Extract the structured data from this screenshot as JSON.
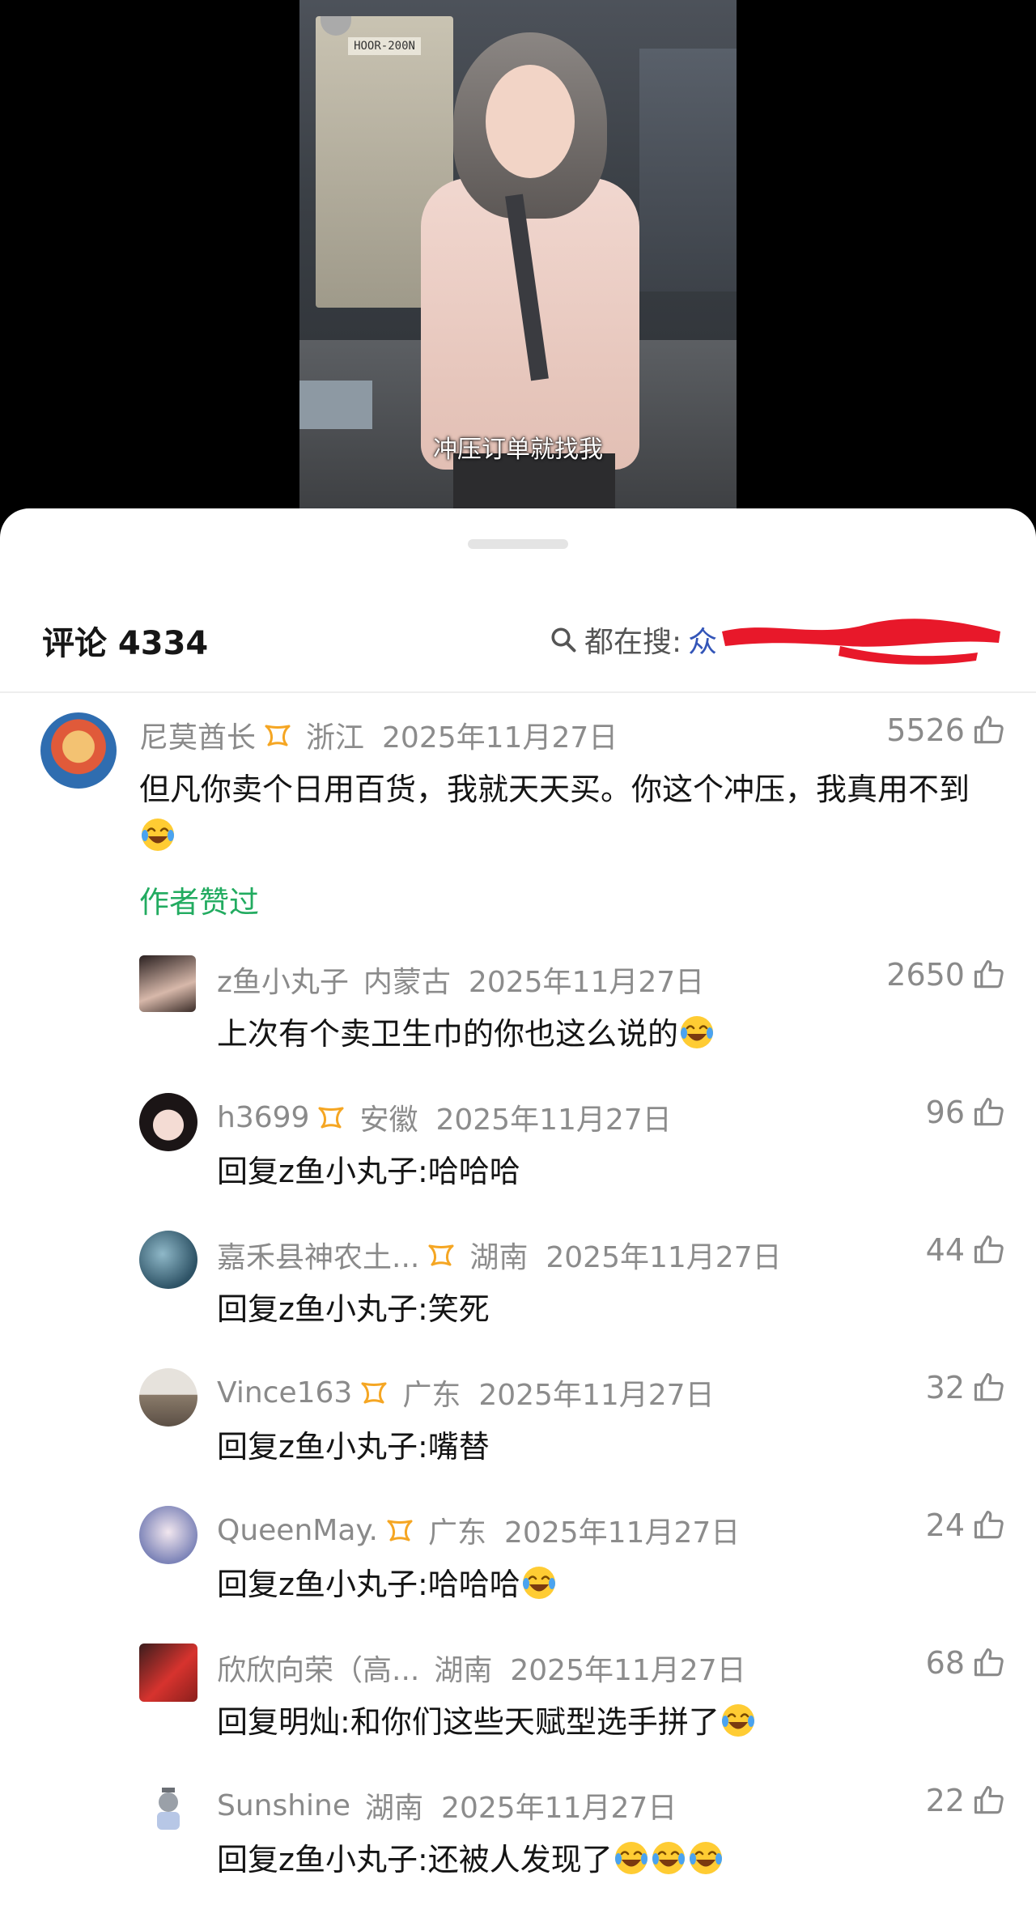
{
  "video": {
    "subtitle": "冲压订单就找我",
    "machine_label": "HOOR-200N"
  },
  "header": {
    "comments_label": "评论 4334",
    "search_prefix": "都在搜:",
    "search_term_visible": "众"
  },
  "comments": [
    {
      "user": "尼莫酋长",
      "location": "浙江",
      "date": "2025年11月27日",
      "likes": "5526",
      "text": "但凡你卖个日用百货，我就天天买。你这个冲压，我真用不到",
      "emoji": "laugh-cry",
      "author_liked": "作者赞过"
    },
    {
      "user": "z鱼小丸子",
      "location": "内蒙古",
      "date": "2025年11月27日",
      "likes": "2650",
      "text": "上次有个卖卫生巾的你也这么说的",
      "emoji": "laugh-cry"
    },
    {
      "user": "h3699",
      "location": "安徽",
      "date": "2025年11月27日",
      "likes": "96",
      "reply_prefix": "回复",
      "reply_to": "z鱼小丸子",
      "text": ":哈哈哈"
    },
    {
      "user": "嘉禾县神农土...",
      "location": "湖南",
      "date": "2025年11月27日",
      "likes": "44",
      "reply_prefix": "回复",
      "reply_to": "z鱼小丸子",
      "text": ":笑死"
    },
    {
      "user": "Vince163",
      "location": "广东",
      "date": "2025年11月27日",
      "likes": "32",
      "reply_prefix": "回复",
      "reply_to": "z鱼小丸子",
      "text": ":嘴替"
    },
    {
      "user": "QueenMay.",
      "location": "广东",
      "date": "2025年11月27日",
      "likes": "24",
      "reply_prefix": "回复",
      "reply_to": "z鱼小丸子",
      "text": ":哈哈哈",
      "emoji": "laugh-cry"
    },
    {
      "user": "欣欣向荣（高...",
      "location": "湖南",
      "date": "2025年11月27日",
      "likes": "68",
      "reply_prefix": "回复",
      "reply_to": "明灿",
      "text": ":和你们这些天赋型选手拼了",
      "emoji": "laugh-cry"
    },
    {
      "user": "Sunshine",
      "location": "湖南",
      "date": "2025年11月27日",
      "likes": "22",
      "reply_prefix": "回复",
      "reply_to": "z鱼小丸子",
      "text": ":还被人发现了",
      "emoji": "laugh-cry"
    }
  ],
  "colors": {
    "accent_green": "#22ab60",
    "badge_orange": "#f5a623",
    "search_blue": "#3355b8",
    "redaction_red": "#e8182a"
  },
  "icons": [
    "search-icon",
    "thumbs-up-icon",
    "creator-badge-icon",
    "laugh-cry-emoji"
  ]
}
